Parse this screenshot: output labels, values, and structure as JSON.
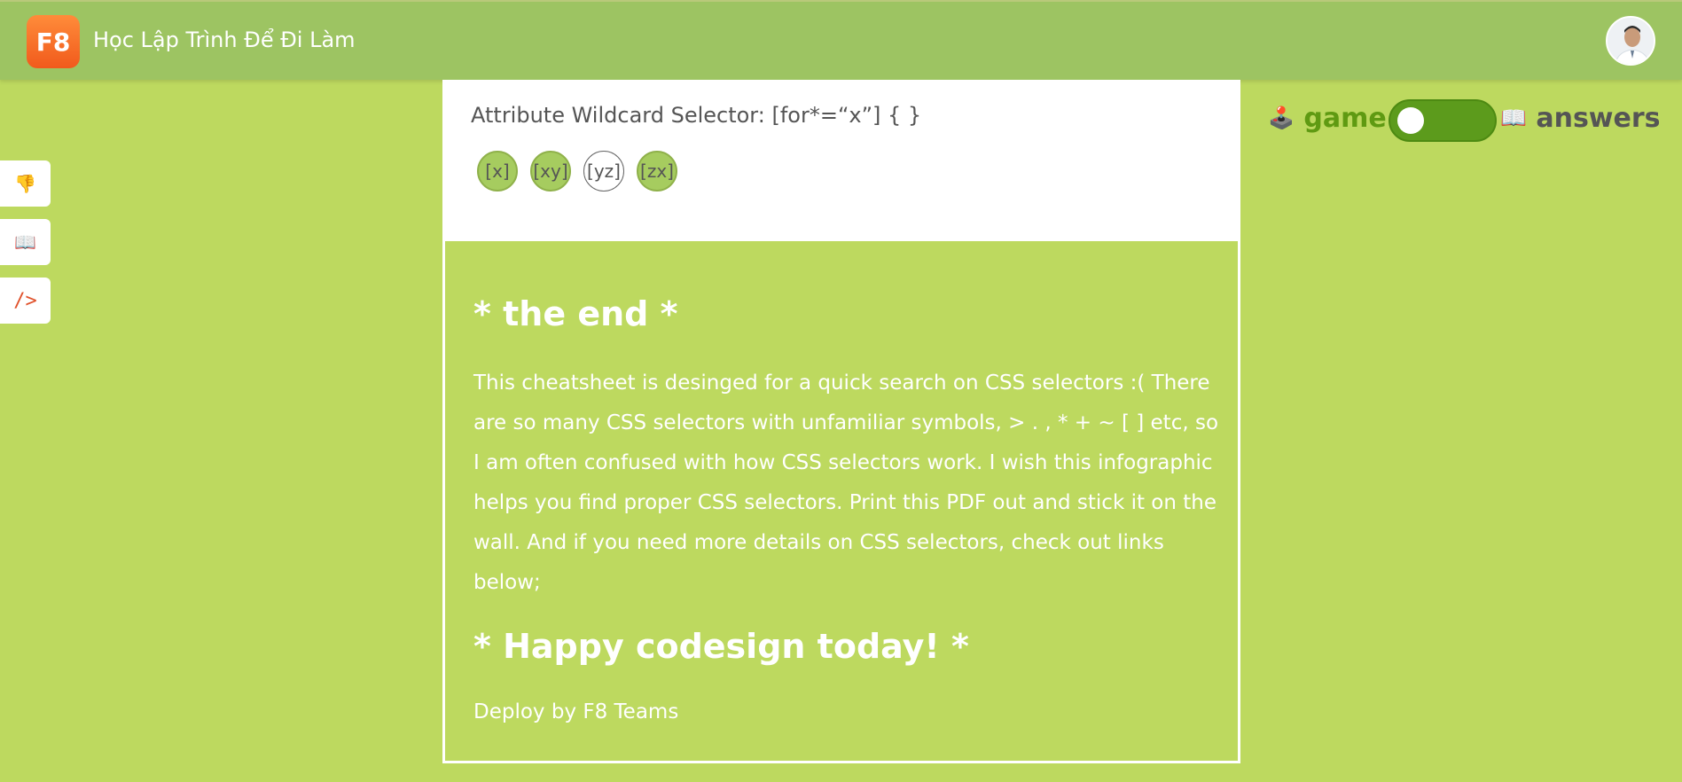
{
  "header": {
    "logo_text": "F8",
    "title": "Học Lập Trình Để Đi Làm"
  },
  "sidebar": {
    "buttons": [
      {
        "icon": "👎"
      },
      {
        "icon": "📖"
      },
      {
        "icon": "/>"
      }
    ]
  },
  "card": {
    "selector_title": "Attribute Wildcard Selector: [for*=“x”] { }",
    "chips": [
      {
        "label": "[x]",
        "state": "on"
      },
      {
        "label": "[xy]",
        "state": "on"
      },
      {
        "label": "[yz]",
        "state": "off"
      },
      {
        "label": "[zx]",
        "state": "on"
      }
    ],
    "end_heading": "* the end *",
    "end_body": "This cheatsheet is desinged for a quick search on CSS selectors :( There are so many CSS selectors with unfamiliar symbols, > . , * + ~ [ ] etc, so I am often confused with how CSS selectors work. I wish this infographic helps you find proper CSS selectors. Print this PDF out and stick it on the wall. And if you need more details on CSS selectors, check out links below;",
    "happy_heading": "* Happy codesign today! *",
    "deploy": "Deploy by F8 Teams"
  },
  "mode_switch": {
    "game_icon": "🕹️",
    "game_label": "game",
    "answers_icon": "📖",
    "answers_label": "answers",
    "toggle_state": "game"
  },
  "colors": {
    "page_bg": "#bdd95f",
    "header_bg": "#9dc462",
    "accent_green": "#5f9a12"
  }
}
